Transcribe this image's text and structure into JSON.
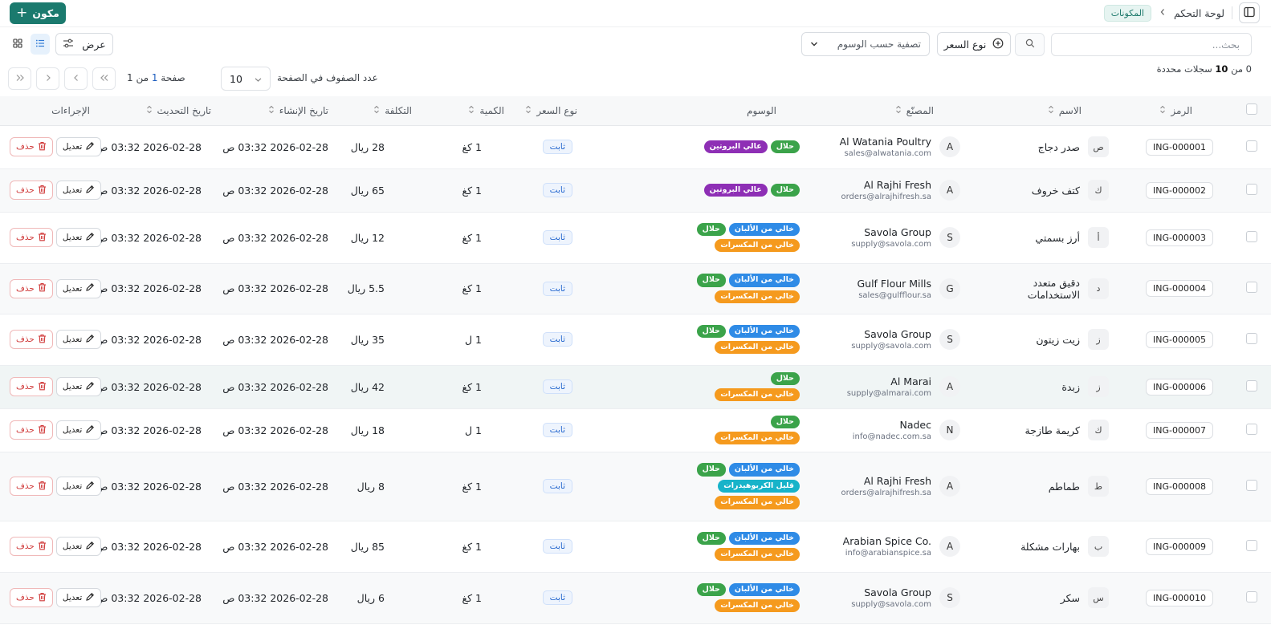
{
  "header": {
    "breadcrumb_root": "لوحة التحكم",
    "breadcrumb_current": "المكونات",
    "add_button": "مكون"
  },
  "toolbar": {
    "search_placeholder": "بحث...",
    "price_type_button": "نوع السعر",
    "tag_filter_placeholder": "تصفية حسب الوسوم",
    "view_button": "عرض"
  },
  "pagination": {
    "selected_prefix": "0 من ",
    "selected_count": "10",
    "selected_suffix": " سجلات محددة",
    "rows_per_page_label": "عدد الصفوف في الصفحة",
    "rows_per_page_value": "10",
    "page_prefix": "صفحة ",
    "page_current": "1",
    "page_suffix": " من 1"
  },
  "columns": {
    "code": "الرمز",
    "name": "الاسم",
    "manufacturer": "المصنّع",
    "tags": "الوسوم",
    "price_type": "نوع السعر",
    "quantity": "الكمية",
    "cost": "التكلفة",
    "created_at": "تاريخ الإنشاء",
    "updated_at": "تاريخ التحديث",
    "actions": "الإجراءات"
  },
  "actions": {
    "edit": "تعديل",
    "delete": "حذف"
  },
  "tag_labels": {
    "halal": "حلال",
    "protein": "عالي البروتين",
    "dairy": "خالي من الألبان",
    "nuts": "خالي من المكسرات",
    "carbs": "قليل الكربوهيدرات"
  },
  "tag_colors": {
    "halal": "#3ba34a",
    "protein": "#8e2fb5",
    "dairy": "#2f8be6",
    "nuts": "#f59a1e",
    "carbs": "#17b3c9"
  },
  "accent_color": "#1b7a6e",
  "rows": [
    {
      "code": "ING-000001",
      "initial": "ص",
      "name": "صدر دجاج",
      "mfr_initial": "A",
      "mfr_name": "Al Watania Poultry",
      "mfr_email": "sales@alwatania.com",
      "tags": [
        "halal",
        "protein"
      ],
      "price_type": "ثابت",
      "quantity": "1 كغ",
      "cost": "28 ريال",
      "created": "2026-02-28 03:32 ص",
      "updated": "2026-02-28 03:32 ص"
    },
    {
      "code": "ING-000002",
      "initial": "ك",
      "name": "كتف خروف",
      "mfr_initial": "A",
      "mfr_name": "Al Rajhi Fresh",
      "mfr_email": "orders@alrajhifresh.sa",
      "tags": [
        "halal",
        "protein"
      ],
      "price_type": "ثابت",
      "quantity": "1 كغ",
      "cost": "65 ريال",
      "created": "2026-02-28 03:32 ص",
      "updated": "2026-02-28 03:32 ص"
    },
    {
      "code": "ING-000003",
      "initial": "أ",
      "name": "أرز بسمتي",
      "mfr_initial": "S",
      "mfr_name": "Savola Group",
      "mfr_email": "supply@savola.com",
      "tags": [
        "dairy",
        "halal",
        "nuts"
      ],
      "price_type": "ثابت",
      "quantity": "1 كغ",
      "cost": "12 ريال",
      "created": "2026-02-28 03:32 ص",
      "updated": "2026-02-28 03:32 ص"
    },
    {
      "code": "ING-000004",
      "initial": "د",
      "name": "دقيق متعدد الاستخدامات",
      "mfr_initial": "G",
      "mfr_name": "Gulf Flour Mills",
      "mfr_email": "sales@gulfflour.sa",
      "tags": [
        "dairy",
        "halal",
        "nuts"
      ],
      "price_type": "ثابت",
      "quantity": "1 كغ",
      "cost": "5.5 ريال",
      "created": "2026-02-28 03:32 ص",
      "updated": "2026-02-28 03:32 ص"
    },
    {
      "code": "ING-000005",
      "initial": "ز",
      "name": "زيت زيتون",
      "mfr_initial": "S",
      "mfr_name": "Savola Group",
      "mfr_email": "supply@savola.com",
      "tags": [
        "dairy",
        "halal",
        "nuts"
      ],
      "price_type": "ثابت",
      "quantity": "1 ل",
      "cost": "35 ريال",
      "created": "2026-02-28 03:32 ص",
      "updated": "2026-02-28 03:32 ص"
    },
    {
      "code": "ING-000006",
      "initial": "ز",
      "name": "زبدة",
      "mfr_initial": "A",
      "mfr_name": "Al Marai",
      "mfr_email": "supply@almarai.com",
      "tags": [
        "halal",
        "nuts"
      ],
      "price_type": "ثابت",
      "quantity": "1 كغ",
      "cost": "42 ريال",
      "created": "2026-02-28 03:32 ص",
      "updated": "2026-02-28 03:32 ص"
    },
    {
      "code": "ING-000007",
      "initial": "ك",
      "name": "كريمة طازجة",
      "mfr_initial": "N",
      "mfr_name": "Nadec",
      "mfr_email": "info@nadec.com.sa",
      "tags": [
        "halal",
        "nuts"
      ],
      "price_type": "ثابت",
      "quantity": "1 ل",
      "cost": "18 ريال",
      "created": "2026-02-28 03:32 ص",
      "updated": "2026-02-28 03:32 ص"
    },
    {
      "code": "ING-000008",
      "initial": "ط",
      "name": "طماطم",
      "mfr_initial": "A",
      "mfr_name": "Al Rajhi Fresh",
      "mfr_email": "orders@alrajhifresh.sa",
      "tags": [
        "dairy",
        "halal",
        "carbs",
        "nuts"
      ],
      "price_type": "ثابت",
      "quantity": "1 كغ",
      "cost": "8 ريال",
      "created": "2026-02-28 03:32 ص",
      "updated": "2026-02-28 03:32 ص"
    },
    {
      "code": "ING-000009",
      "initial": "ب",
      "name": "بهارات مشكلة",
      "mfr_initial": "A",
      "mfr_name": "Arabian Spice Co.",
      "mfr_email": "info@arabianspice.sa",
      "tags": [
        "dairy",
        "halal",
        "nuts"
      ],
      "price_type": "ثابت",
      "quantity": "1 كغ",
      "cost": "85 ريال",
      "created": "2026-02-28 03:32 ص",
      "updated": "2026-02-28 03:32 ص"
    },
    {
      "code": "ING-000010",
      "initial": "س",
      "name": "سكر",
      "mfr_initial": "S",
      "mfr_name": "Savola Group",
      "mfr_email": "supply@savola.com",
      "tags": [
        "dairy",
        "halal",
        "nuts"
      ],
      "price_type": "ثابت",
      "quantity": "1 كغ",
      "cost": "6 ريال",
      "created": "2026-02-28 03:32 ص",
      "updated": "2026-02-28 03:32 ص"
    }
  ]
}
